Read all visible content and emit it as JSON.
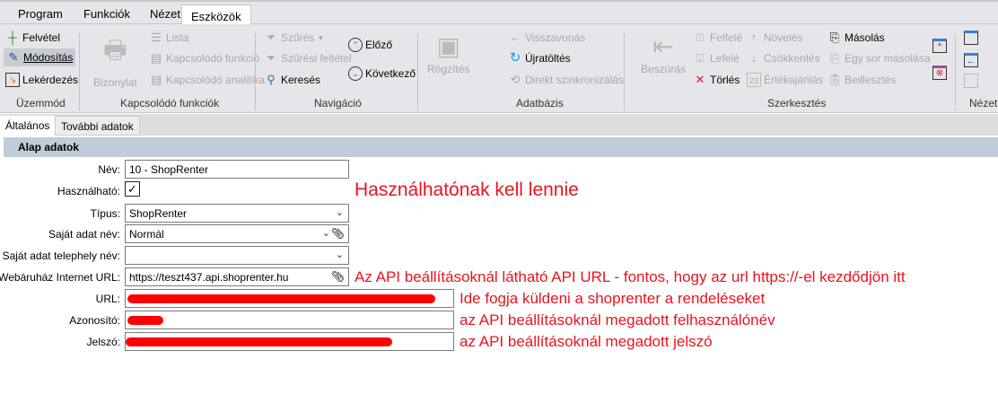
{
  "menu_tabs": [
    "Program",
    "Funkciók",
    "Nézet",
    "Eszközök"
  ],
  "active_tab": "Eszközök",
  "ribbon": {
    "uzemmod": {
      "label": "Üzemmód",
      "items": [
        "Felvétel",
        "Módosítás",
        "Lekérdezés"
      ]
    },
    "kapcsolodo": {
      "label": "Kapcsolódó funkciók",
      "bizonylat": "Bizonylat",
      "items": [
        "Lista",
        "Kapcsolódó funkció",
        "Kapcsolódó analitika"
      ]
    },
    "navigacio": {
      "label": "Navigáció",
      "items": [
        "Szűrés",
        "Szűrési feltétel",
        "Keresés",
        "Előző",
        "Következő"
      ]
    },
    "adatbazis": {
      "label": "Adatbázis",
      "rogzites": "Rögzítés",
      "items": [
        "Visszavonás",
        "Újratöltés",
        "Direkt szinkronizálás"
      ]
    },
    "szerkesztes": {
      "label": "Szerkesztés",
      "beszuras": "Beszúrás",
      "items": [
        "Felfelé",
        "Lefelé",
        "Törlés",
        "Növelés",
        "Csökkentés",
        "Értékajánlás",
        "Másolás",
        "Egy sor másolása",
        "Beillesztés"
      ]
    },
    "nezet": {
      "label": "Nézet"
    }
  },
  "subtabs": [
    "Általános",
    "További adatok"
  ],
  "section_title": "Alap adatok",
  "form": {
    "nev": {
      "label": "Név:",
      "value": "10 - ShopRenter"
    },
    "hasznalhato": {
      "label": "Használható:",
      "checked": true,
      "mark": "✓"
    },
    "tipus": {
      "label": "Típus:",
      "value": "ShopRenter"
    },
    "sajat_adat_nev": {
      "label": "Saját adat név:",
      "value": "Normál"
    },
    "sajat_telephely": {
      "label": "Saját adat telephely név:",
      "value": ""
    },
    "webaruhaz_url": {
      "label": "Webáruház Internet URL:",
      "value": "https://teszt437.api.shoprenter.hu"
    },
    "url": {
      "label": "URL:"
    },
    "azonosito": {
      "label": "Azonosító:"
    },
    "jelszo": {
      "label": "Jelszó:"
    }
  },
  "annotations": {
    "hasznalhato": "Használhatónak kell lennie",
    "webaruhaz_url": "Az API beállításoknál látható API URL - fontos, hogy az url https://-el kezdődjön itt",
    "url": "Ide fogja küldeni a shoprenter a rendeléseket",
    "azonosito": "az API beállításoknál megadott felhasználónév",
    "jelszo": "az API beállításoknál megadott jelszó"
  },
  "colors": {
    "annotation": "#e8141e",
    "redaction": "#ff0000",
    "section": "#c0ccd8"
  }
}
